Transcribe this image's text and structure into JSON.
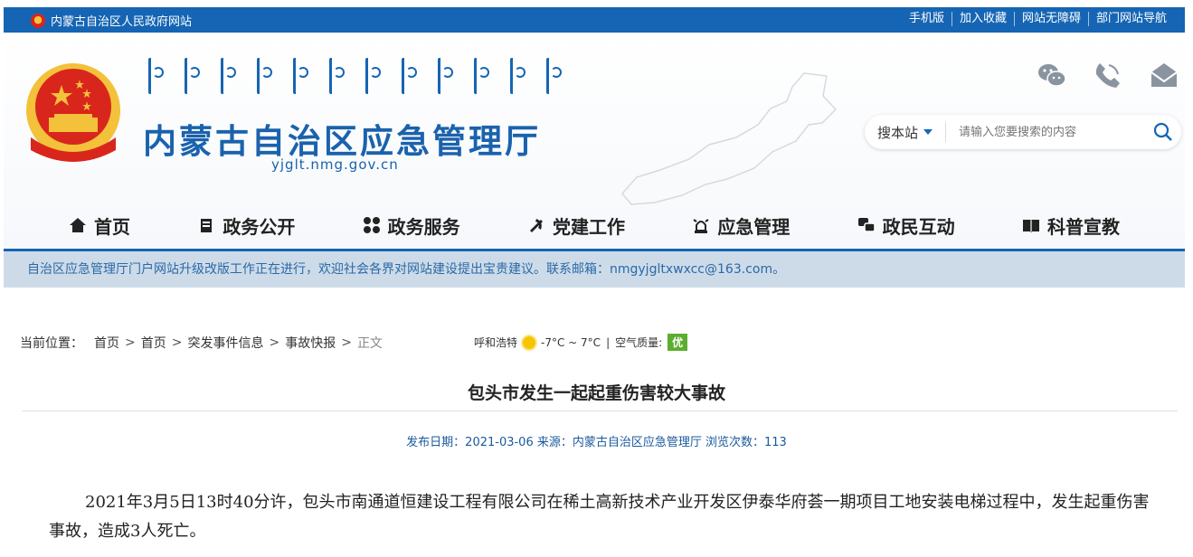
{
  "topbar": {
    "site_link": "内蒙古自治区人民政府网站",
    "links": [
      "手机版",
      "加入收藏",
      "网站无障碍",
      "部门网站导航"
    ]
  },
  "header": {
    "title": "内蒙古自治区应急管理厅",
    "domain": "yjglt.nmg.gov.cn"
  },
  "search": {
    "scope": "搜本站",
    "placeholder": "请输入您要搜索的内容"
  },
  "nav": {
    "items": [
      "首页",
      "政务公开",
      "政务服务",
      "党建工作",
      "应急管理",
      "政民互动",
      "科普宣教"
    ]
  },
  "notice": "自治区应急管理厅门户网站升级改版工作正在进行，欢迎社会各界对网站建设提出宝贵建议。联系邮箱：nmgyjgltxwxcc@163.com。",
  "breadcrumb": {
    "label": "当前位置：",
    "items": [
      "首页",
      "首页",
      "突发事件信息",
      "事故快报"
    ],
    "current": "正文"
  },
  "weather": {
    "city": "呼和浩特",
    "temp": "-7°C ~ 7°C",
    "aqi_label": "空气质量:",
    "aqi_value": "优"
  },
  "article": {
    "title": "包头市发生一起起重伤害较大事故",
    "meta": "发布日期：2021-03-06 来源：内蒙古自治区应急管理厅 浏览次数：113",
    "body": "2021年3月5日13时40分许，包头市南通道恒建设工程有限公司在稀土高新技术产业开发区伊泰华府荟一期项目工地安装电梯过程中，发生起重伤害事故，造成3人死亡。"
  },
  "colors": {
    "brand_blue": "#1565b4",
    "notice_bg": "#cddbe8",
    "aqi_green": "#5cae2e"
  }
}
